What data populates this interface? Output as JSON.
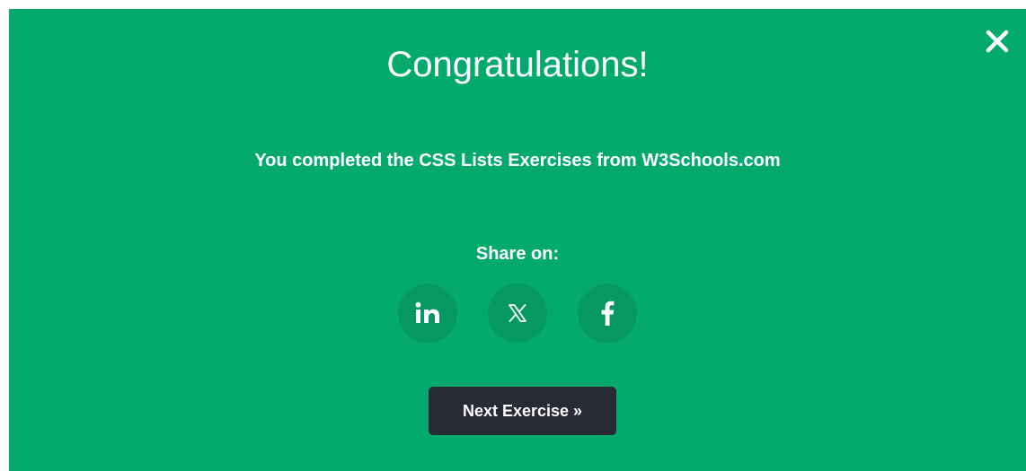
{
  "modal": {
    "background_color": "#04aa6d",
    "title": "Congratulations!",
    "message": "You completed the CSS Lists Exercises from W3Schools.com",
    "close_icon": "close-icon"
  },
  "share": {
    "label": "Share on:",
    "buttons": [
      {
        "name": "LinkedIn",
        "icon": "linkedin-icon"
      },
      {
        "name": "X",
        "icon": "x-icon"
      },
      {
        "name": "Facebook",
        "icon": "facebook-icon"
      }
    ],
    "button_color": "#059862"
  },
  "next_button": {
    "label": "Next Exercise »",
    "background_color": "#282a35"
  }
}
